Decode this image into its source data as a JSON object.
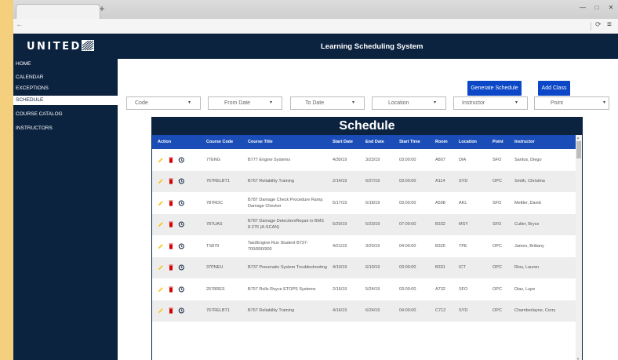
{
  "browser": {
    "new_tab_label": "+",
    "back_label": "←",
    "reload_label": "⟳",
    "menu_label": "≡",
    "minimize_label": "—",
    "maximize_label": "□",
    "close_label": "✕"
  },
  "header": {
    "logo_text": "UNITED",
    "title": "Learning Scheduling System"
  },
  "sidebar": {
    "items": [
      {
        "label": "HOME"
      },
      {
        "label": "CALENDAR"
      },
      {
        "label": "EXCEPTIONS"
      },
      {
        "label": "SCHEDULE"
      },
      {
        "label": "COURSE CATALOG"
      },
      {
        "label": "INSTRUCTORS"
      }
    ]
  },
  "toolbar": {
    "generate_label": "Generate Schedule",
    "add_class_label": "Add Class"
  },
  "filters": {
    "code": "Code",
    "from_date": "From Date",
    "to_date": "To Date",
    "location": "Location",
    "instructor": "Instructor",
    "point": "Point",
    "caret": "▾"
  },
  "schedule": {
    "title": "Schedule",
    "columns": [
      "Action",
      "Course Code",
      "Course Title",
      "Start Date",
      "End Date",
      "Start Time",
      "Room",
      "Location",
      "Point",
      "Instructor"
    ],
    "rows": [
      {
        "code": "77ENG",
        "title": "B777 Engine Systems",
        "start": "4/30/19",
        "end": "3/23/19",
        "time": "03:00:00",
        "room": "A807",
        "location": "DIA",
        "point": "SFO",
        "instructor": "Santos, Diego"
      },
      {
        "code": "767RELBT1",
        "title": "B767 Reliability Training",
        "start": "2/14/19",
        "end": "6/27/19",
        "time": "03:00:00",
        "room": "A114",
        "location": "SYD",
        "point": "OPC",
        "instructor": "Smith, Christina"
      },
      {
        "code": "787RDC",
        "title": "B787 Damage Check Procedure Ramp Damage Checker",
        "start": "5/17/19",
        "end": "6/18/19",
        "time": "03:00:00",
        "room": "A598",
        "location": "AKL",
        "point": "SFO",
        "instructor": "Mettler, David"
      },
      {
        "code": "787UAS",
        "title": "B787 Damage Detection/Repair in BMS 8-276 (A-SCAN)",
        "start": "5/20/19",
        "end": "5/23/19",
        "time": "07:00:00",
        "room": "B332",
        "location": "MSY",
        "point": "SFO",
        "instructor": "Cutler, Bryce"
      },
      {
        "code": "TS879",
        "title": "Taxi/Engine Run Student B737-700/800/900",
        "start": "4/21/19",
        "end": "3/20/19",
        "time": "04:00:00",
        "room": "B325",
        "location": "TPE",
        "point": "OPC",
        "instructor": "James, Brittany"
      },
      {
        "code": "37PNEU",
        "title": "B737 Pneumatic System Troubleshooting",
        "start": "4/10/19",
        "end": "6/10/19",
        "time": "03:00:00",
        "room": "B331",
        "location": "ICT",
        "point": "OPC",
        "instructor": "Rios, Lauren"
      },
      {
        "code": "2578RES",
        "title": "B757 Rolls Royce ETOPS Systems",
        "start": "2/16/19",
        "end": "5/24/19",
        "time": "03:00:00",
        "room": "A732",
        "location": "SFO",
        "point": "OPC",
        "instructor": "Diaz, Lupe"
      },
      {
        "code": "767RELBT1",
        "title": "B767 Reliability Training",
        "start": "4/16/19",
        "end": "6/24/19",
        "time": "04:00:00",
        "room": "C712",
        "location": "SYD",
        "point": "OPC",
        "instructor": "Chamberlayne, Corry"
      }
    ]
  },
  "colors": {
    "navy": "#0c2340",
    "table_header": "#1a4db8",
    "button": "#0b47c6",
    "edit": "#f5c518",
    "delete": "#d50000",
    "history": "#0c2340",
    "background": "#f3cf7e"
  }
}
